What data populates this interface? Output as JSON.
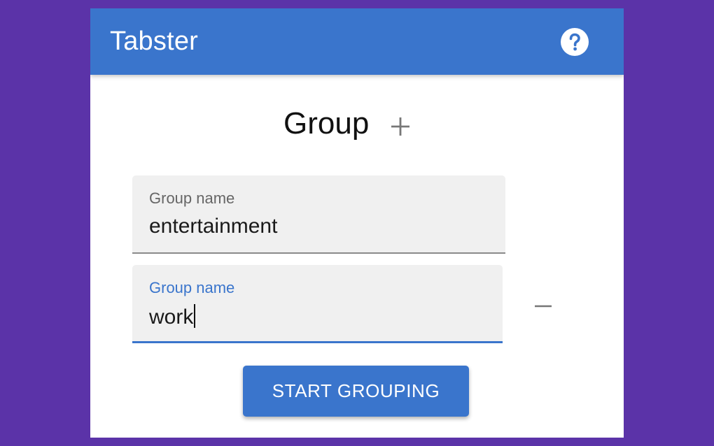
{
  "app": {
    "title": "Tabster",
    "accent_color": "#3a75cc",
    "background_color": "#5b33a8",
    "help_icon": "help-circle-icon"
  },
  "main": {
    "heading": "Group",
    "add_icon": "plus-icon",
    "groups": [
      {
        "label": "Group name",
        "value": "entertainment",
        "focused": false
      },
      {
        "label": "Group name",
        "value": "work",
        "focused": true
      }
    ],
    "remove_icon": "minus-icon",
    "start_button_label": "START GROUPING"
  }
}
